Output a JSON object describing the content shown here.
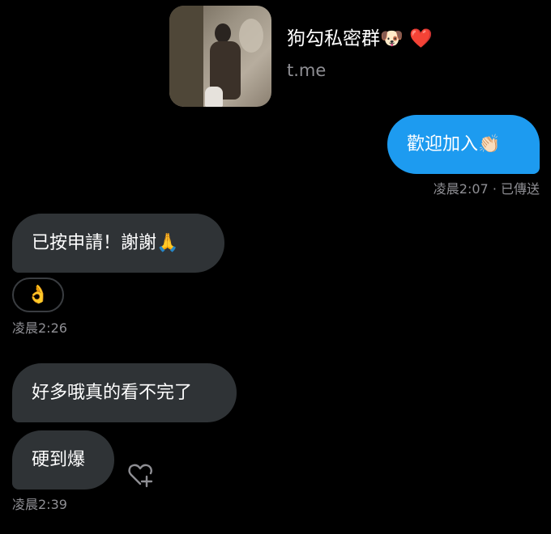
{
  "link_preview": {
    "title": "狗勾私密群🐶 ❤️",
    "host": "t.me"
  },
  "messages": [
    {
      "direction": "outgoing",
      "text": "歡迎加入👏🏻"
    },
    {
      "direction": "incoming",
      "text": "已按申請！謝謝🙏"
    },
    {
      "direction": "incoming",
      "text": "好多哦真的看不完了"
    },
    {
      "direction": "incoming",
      "text": "硬到爆"
    }
  ],
  "meta": {
    "sent_status": "凌晨2:07 · 已傳送",
    "time_1": "凌晨2:26",
    "time_2": "凌晨2:39"
  },
  "reactions": {
    "ok_hand": "👌"
  },
  "icons": {
    "react": "heart-plus-icon"
  },
  "colors": {
    "outgoing_bubble": "#1d9bf0",
    "incoming_bubble": "#2f3336",
    "meta_text": "#8f8f94"
  }
}
